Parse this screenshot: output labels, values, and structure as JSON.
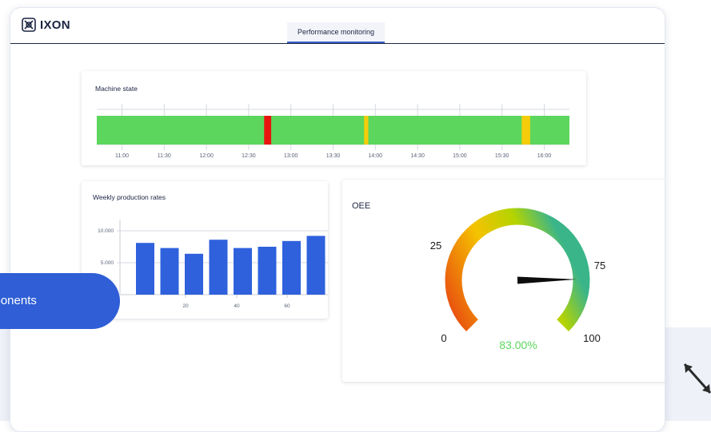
{
  "app": {
    "logo_text": "IXON",
    "tab_label": "Performance monitoring"
  },
  "machine_state": {
    "title": "Machine state",
    "time_ticks": [
      "11:00",
      "11:30",
      "12:00",
      "12:30",
      "13:00",
      "13:30",
      "14:00",
      "14:30",
      "15:00",
      "15:30",
      "16:00"
    ],
    "colors": {
      "running": "#5cd65c",
      "stopped": "#e8150f",
      "warning": "#f5cc0a"
    },
    "events": [
      {
        "state": "stopped",
        "start": "12:41",
        "end": "12:46"
      },
      {
        "state": "warning",
        "start": "13:52",
        "end": "13:55"
      },
      {
        "state": "warning",
        "start": "15:44",
        "end": "15:50"
      }
    ]
  },
  "chart_data": [
    {
      "type": "bar",
      "title": "Weekly production rates",
      "x_ticks": [
        "20",
        "40",
        "60"
      ],
      "y_ticks": [
        "10.000",
        "5.000"
      ],
      "ylim": [
        0,
        11000
      ],
      "values": [
        8100,
        7300,
        6400,
        8600,
        7300,
        7500,
        8400,
        9200
      ],
      "color": "#2f61dd"
    },
    {
      "type": "gauge",
      "title": "OEE",
      "value": 83.0,
      "value_label": "83.00%",
      "range": [
        0,
        100
      ],
      "tick_labels": [
        "0",
        "25",
        "75",
        "100"
      ],
      "colors": {
        "low": "#e84a10",
        "mid": "#f5c200",
        "high": "#3ab58a",
        "value_text": "#5cd65c"
      }
    }
  ],
  "overlay": {
    "pill_text": "mponents"
  }
}
